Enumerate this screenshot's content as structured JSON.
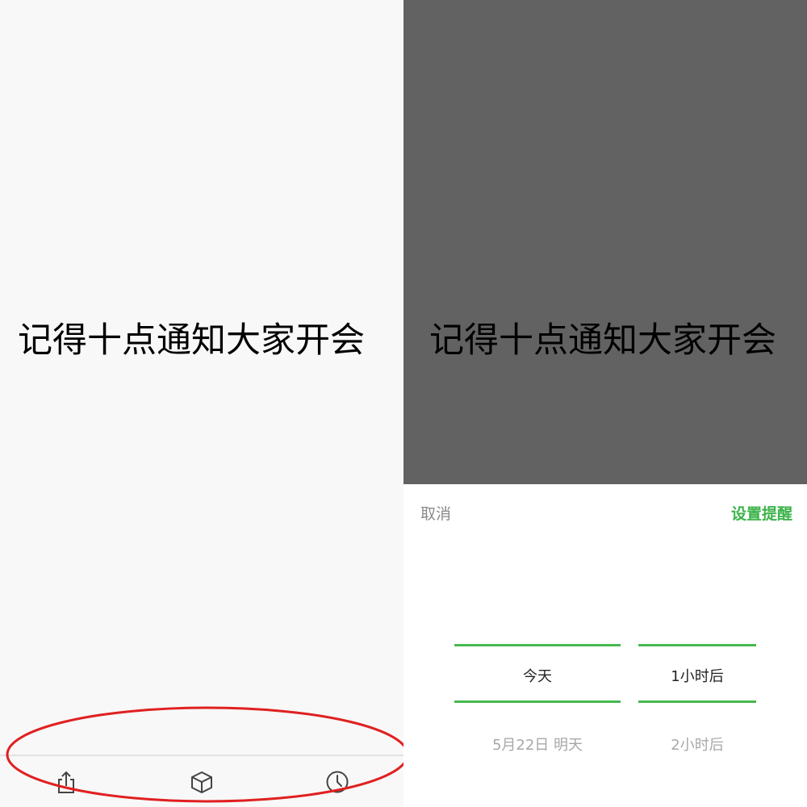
{
  "note": {
    "text": "记得十点通知大家开会"
  },
  "toolbar": {
    "icons": [
      "share-icon",
      "box-icon",
      "clock-icon"
    ]
  },
  "annotation": {
    "color": "#e02020"
  },
  "reminder_sheet": {
    "cancel_label": "取消",
    "confirm_label": "设置提醒",
    "accent_color": "#3cb34a",
    "date_picker": {
      "selected": "今天",
      "next": "5月22日 明天"
    },
    "hour_picker": {
      "selected": "1小时后",
      "next": "2小时后"
    }
  },
  "colors": {
    "overlay": "#626262",
    "left_background": "#f8f8f8"
  }
}
